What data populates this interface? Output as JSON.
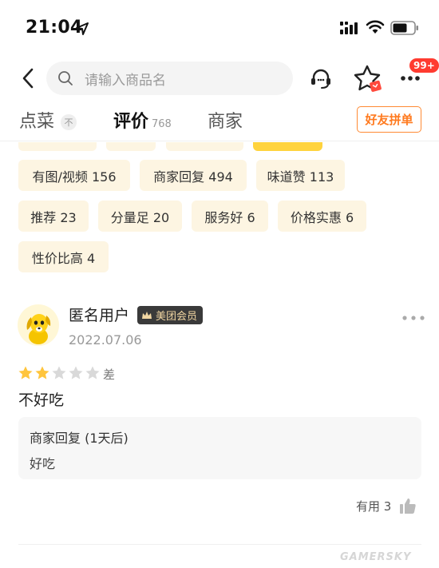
{
  "status_bar": {
    "time": "21:04"
  },
  "search": {
    "placeholder": "请输入商品名"
  },
  "badge": {
    "count": "99+"
  },
  "tabs": [
    {
      "label": "点菜",
      "pin": "不"
    },
    {
      "label": "评价",
      "count": "768"
    },
    {
      "label": "商家"
    }
  ],
  "group_button": "好友拼单",
  "tags": [
    "有图/视频 156",
    "商家回复 494",
    "味道赞 113",
    "推荐 23",
    "分量足 20",
    "服务好 6",
    "价格实惠 6",
    "性价比高 4"
  ],
  "review": {
    "user": "匿名用户",
    "member": "美团会员",
    "date": "2022.07.06",
    "stars": 2,
    "max_stars": 5,
    "rating_label": "差",
    "content": "不好吃",
    "reply_title": "商家回复 (1天后)",
    "reply_text": "好吃",
    "helpful": "有用 3"
  },
  "colors": {
    "accent_orange": "#ff7a1f",
    "chip_bg": "#fdf5e2",
    "star_filled": "#ffc53d",
    "star_empty": "#d9d9d9",
    "badge_red": "#ff3b30"
  },
  "watermark": "GAMERSKY"
}
